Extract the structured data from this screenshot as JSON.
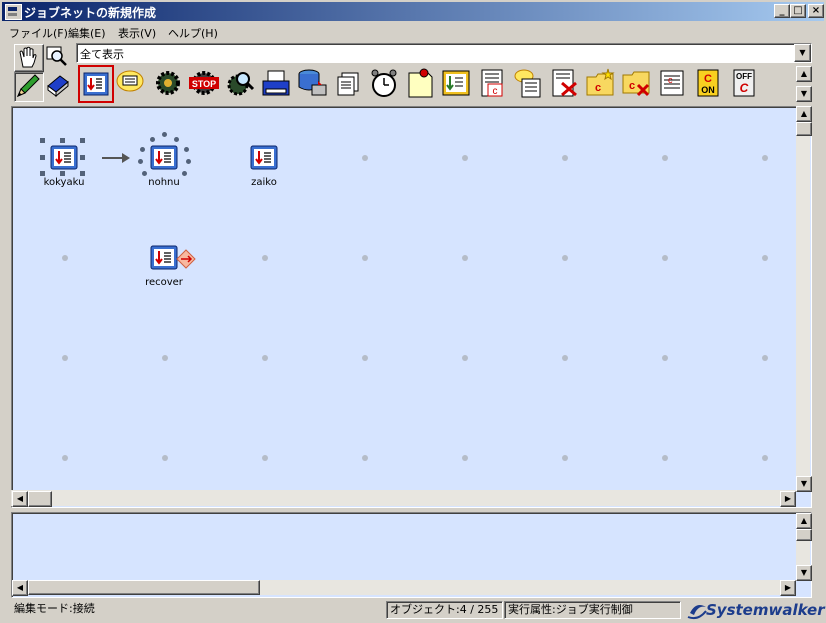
{
  "window": {
    "title": "ジョブネットの新規作成",
    "buttons": {
      "minimize": "_",
      "maximize": "□",
      "close": "×"
    }
  },
  "menu": [
    {
      "label": "ファイル(F)"
    },
    {
      "label": "編集(E)"
    },
    {
      "label": "表示(V)"
    },
    {
      "label": "ヘルプ(H)"
    }
  ],
  "filter": {
    "selected": "全て表示"
  },
  "palette": [
    "hand-icon",
    "zoom-icon",
    "pencil-icon",
    "book-icon"
  ],
  "toolbar": {
    "icons": [
      "job-icon",
      "message-icon",
      "gear-job-icon",
      "stop-icon",
      "search-gear-icon",
      "printer-icon",
      "database-icon",
      "document-icon",
      "alarm-clock-icon",
      "note-icon",
      "job-c-icon",
      "document-c-icon",
      "message-c-icon",
      "c-delete-icon",
      "folder-c-new-icon",
      "folder-c-delete-icon",
      "list-c-icon",
      "c-on-icon",
      "c-off-icon"
    ],
    "on_label": "ON",
    "off_label": "OFF",
    "stop_label": "STOP"
  },
  "canvas": {
    "jobs": [
      {
        "name": "kokyaku",
        "state": "selected"
      },
      {
        "name": "nohnu",
        "state": "linking"
      },
      {
        "name": "zaiko",
        "state": "normal"
      },
      {
        "name": "recover",
        "state": "recovery"
      }
    ]
  },
  "status": {
    "mode": "編集モード:接続",
    "objects": "オブジェクト:4 / 255",
    "attribute": "実行属性:ジョブ実行制御",
    "brand": "Systemwalker"
  },
  "colors": {
    "title_start": "#0a246a",
    "title_end": "#a6caf0",
    "canvas_bg": "#d6e4ff",
    "job_blue": "#3a6fd0",
    "arrow_red": "#d00000",
    "brand": "#1c3c8c"
  }
}
